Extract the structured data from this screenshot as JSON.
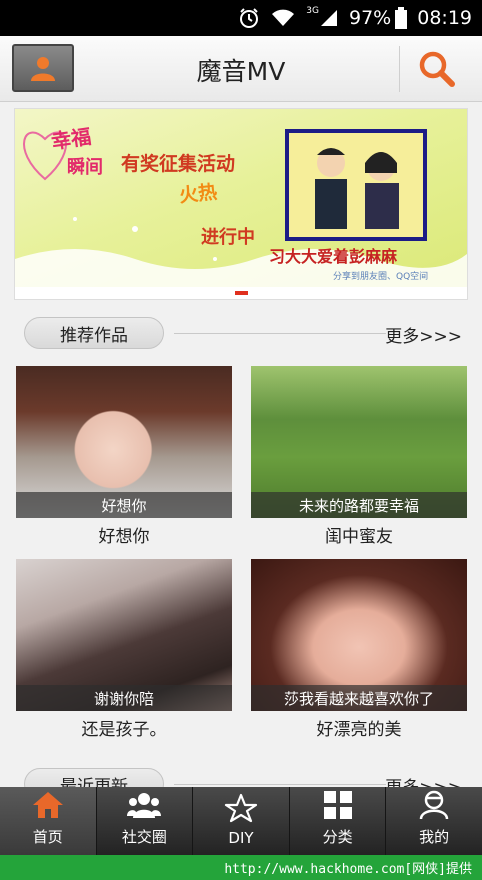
{
  "status_bar": {
    "network": "3G",
    "battery": "97%",
    "time": "08:19"
  },
  "header": {
    "title": "魔音MV"
  },
  "banner": {
    "line1": "幸福",
    "line2": "瞬间",
    "main1": "有奖征集活动",
    "main2": "火热",
    "main3": "进行中",
    "name": "习大大爱着彭麻麻",
    "share": "分享到朋友圈、QQ空间"
  },
  "recommend": {
    "label": "推荐作品",
    "more": "更多>>>",
    "items": [
      {
        "caption": "好想你",
        "title": "好想你"
      },
      {
        "caption": "未来的路都要幸福",
        "title": "闺中蜜友"
      },
      {
        "caption": "谢谢你陪",
        "title": "还是孩子。"
      },
      {
        "caption": "莎我看越来越喜欢你了",
        "title": "好漂亮的美"
      }
    ]
  },
  "recent": {
    "label": "最近更新",
    "more": "更多>>>"
  },
  "tabs": [
    {
      "label": "首页",
      "icon": "home-icon"
    },
    {
      "label": "社交圈",
      "icon": "people-icon"
    },
    {
      "label": "DIY",
      "icon": "star-icon"
    },
    {
      "label": "分类",
      "icon": "grid-icon"
    },
    {
      "label": "我的",
      "icon": "user-icon"
    }
  ],
  "watermark": "http://www.hackhome.com[网侠]提供",
  "colors": {
    "accent": "#e8682a",
    "tab_bar": "#2e2e2e",
    "watermark_bg": "#24a43a"
  }
}
